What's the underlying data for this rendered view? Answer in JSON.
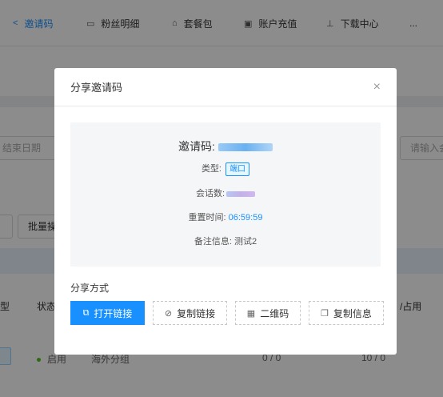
{
  "topnav": {
    "tabs": [
      {
        "label": "邀请码",
        "icon": "share-icon",
        "active": true
      },
      {
        "label": "粉丝明细",
        "icon": "id-card-icon",
        "active": false
      },
      {
        "label": "套餐包",
        "icon": "bag-icon",
        "active": false
      },
      {
        "label": "账户充值",
        "icon": "wallet-icon",
        "active": false
      },
      {
        "label": "下载中心",
        "icon": "download-icon",
        "active": false
      }
    ],
    "more": "..."
  },
  "background": {
    "date_placeholder": "结束日期",
    "search_placeholder": "请输入会",
    "batch_button": "批量操",
    "col_type": "型",
    "col_status": "状态",
    "col_occupied": "/占用",
    "row": {
      "status": "启用",
      "group": "海外分组",
      "count1": "0 / 0",
      "count2": "10 / 0"
    }
  },
  "modal": {
    "title": "分享邀请码",
    "close": "×",
    "invite_code_label": "邀请码:",
    "type_label": "类型:",
    "type_value": "端口",
    "session_label": "会话数:",
    "reset_time_label": "重置时间:",
    "reset_time_value": "06:59:59",
    "note_label": "备注信息:",
    "note_value": "测试2",
    "share_method_title": "分享方式",
    "buttons": {
      "open_link": "打开链接",
      "copy_link": "复制链接",
      "qr_code": "二维码",
      "copy_info": "复制信息"
    }
  },
  "colors": {
    "primary": "#1890ff",
    "overlay": "rgba(0,0,0,0.45)"
  }
}
